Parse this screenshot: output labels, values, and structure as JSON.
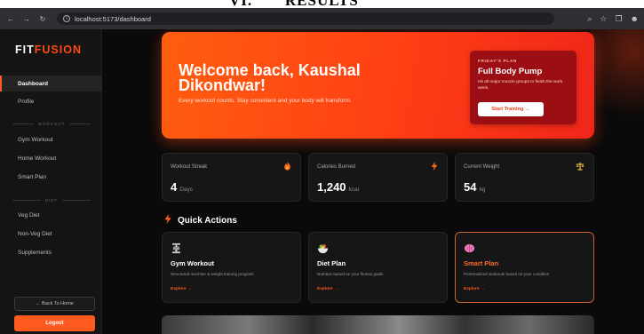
{
  "doc_heading": "VI.       RESULTS",
  "browser": {
    "back_icon": "back-arrow-icon",
    "forward_icon": "forward-arrow-icon",
    "reload_icon": "reload-icon",
    "url": "localhost:5173/dashboard"
  },
  "sidebar": {
    "logo_part1": "FIT",
    "logo_part2": "FUSION",
    "items_main": [
      {
        "label": "Dashboard",
        "active": true
      },
      {
        "label": "Profile",
        "active": false
      }
    ],
    "section_workout": "WORKOUT",
    "items_workout": [
      {
        "label": "Gym Workout"
      },
      {
        "label": "Home Workout"
      },
      {
        "label": "Smart Plan"
      }
    ],
    "section_diet": "DIET",
    "items_diet": [
      {
        "label": "Veg Diet"
      },
      {
        "label": "Non-Veg Diet"
      },
      {
        "label": "Supplements"
      }
    ],
    "back_label": "← Back To Home",
    "logout_label": "Logout"
  },
  "hero": {
    "title": "Welcome back, Kaushal Dikondwar!",
    "subtitle": "Every workout counts. Stay consistent and your body will transform.",
    "plan": {
      "tag": "FRIDAY'S PLAN",
      "name": "Full Body Pump",
      "description": "Hit all major muscle groups to finish the work week.",
      "button": "Start Training →"
    }
  },
  "stats": [
    {
      "label": "Workout Streak",
      "value": "4",
      "unit": "Days",
      "icon": "flame-icon"
    },
    {
      "label": "Calories Burned",
      "value": "1,240",
      "unit": "kcal",
      "icon": "bolt-icon"
    },
    {
      "label": "Current Weight",
      "value": "54",
      "unit": "kg",
      "icon": "scale-icon"
    }
  ],
  "quick_actions": {
    "heading": "Quick Actions",
    "cards": [
      {
        "title": "Gym Workout",
        "description": "Structured machine & weight training program",
        "link": "Explore →",
        "icon": "dumbbell-icon"
      },
      {
        "title": "Diet Plan",
        "description": "Nutrition based on your fitness goals",
        "link": "Explore →",
        "icon": "salad-bowl-icon"
      },
      {
        "title": "Smart Plan",
        "description": "Personalized workouts based on your condition",
        "link": "Explore →",
        "icon": "brain-icon"
      }
    ]
  },
  "colors": {
    "accent": "#ff5a1f",
    "hero_start": "#ff5e10",
    "hero_end": "#f0261a",
    "plan_card": "#9b0f14",
    "background": "#0a0a0a"
  }
}
